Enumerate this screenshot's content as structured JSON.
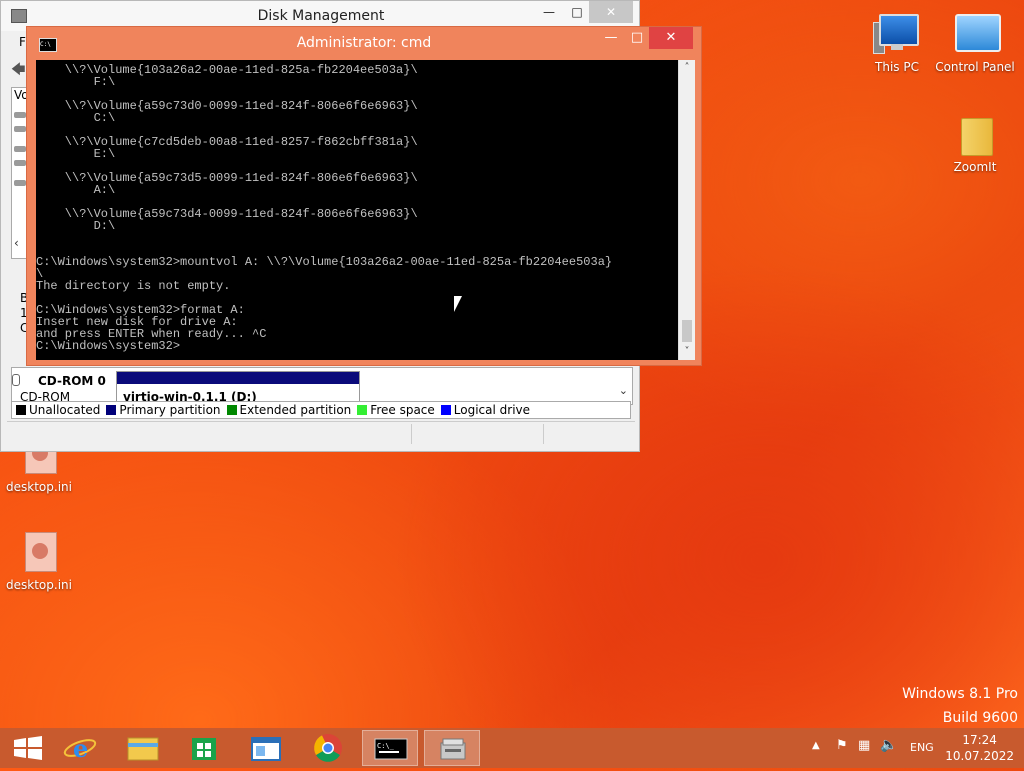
{
  "desktop": {
    "icons": [
      {
        "label": "This PC"
      },
      {
        "label": "Control Panel"
      },
      {
        "label": "ZoomIt"
      },
      {
        "label": "desktop.ini"
      },
      {
        "label": "desktop.ini"
      }
    ],
    "watermark_edition": "Windows 8.1 Pro",
    "watermark_build": "Build 9600"
  },
  "disk_mgmt": {
    "title": "Disk Management",
    "menu_first": "Fi",
    "list_header": "Vo",
    "left_chars": [
      "B",
      "1",
      "C"
    ],
    "cdrom_label": "CD-ROM 0",
    "cdrom_sub": "CD-ROM",
    "volume_name": "virtio-win-0.1.1 (D:)",
    "legend": [
      {
        "label": "Unallocated",
        "color": "#000000"
      },
      {
        "label": "Primary partition",
        "color": "#00007a"
      },
      {
        "label": "Extended partition",
        "color": "#008800"
      },
      {
        "label": "Free space",
        "color": "#33ee33"
      },
      {
        "label": "Logical drive",
        "color": "#0000ff"
      }
    ]
  },
  "cmd": {
    "title": "Administrator: cmd",
    "output": "    \\\\?\\Volume{103a26a2-00ae-11ed-825a-fb2204ee503a}\\\n        F:\\\n\n    \\\\?\\Volume{a59c73d0-0099-11ed-824f-806e6f6e6963}\\\n        C:\\\n\n    \\\\?\\Volume{c7cd5deb-00a8-11ed-8257-f862cbff381a}\\\n        E:\\\n\n    \\\\?\\Volume{a59c73d5-0099-11ed-824f-806e6f6e6963}\\\n        A:\\\n\n    \\\\?\\Volume{a59c73d4-0099-11ed-824f-806e6f6e6963}\\\n        D:\\\n\n\nC:\\Windows\\system32>mountvol A: \\\\?\\Volume{103a26a2-00ae-11ed-825a-fb2204ee503a}\n\\\nThe directory is not empty.\n\nC:\\Windows\\system32>format A:\nInsert new disk for drive A:\nand press ENTER when ready... ^C\nC:\\Windows\\system32>"
  },
  "taskbar": {
    "language": "ENG",
    "time": "17:24",
    "date": "10.07.2022"
  }
}
